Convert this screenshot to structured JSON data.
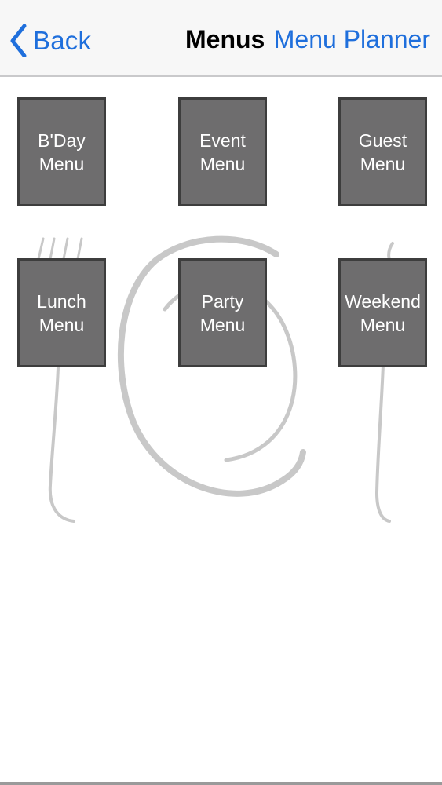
{
  "navbar": {
    "back_label": "Back",
    "title": "Menus",
    "right_label": "Menu Planner"
  },
  "menus": [
    {
      "line1": "B'Day",
      "line2": "Menu"
    },
    {
      "line1": "Event",
      "line2": "Menu"
    },
    {
      "line1": "Guest",
      "line2": "Menu"
    },
    {
      "line1": "Lunch",
      "line2": "Menu"
    },
    {
      "line1": "Party",
      "line2": "Menu"
    },
    {
      "line1": "Weekend",
      "line2": "Menu"
    }
  ],
  "colors": {
    "accent": "#1f6fdc",
    "tile_fill": "#6e6d6e",
    "tile_border": "#3d3d3d",
    "navbar_bg": "#f7f7f7",
    "art_stroke": "#c8c8c8"
  },
  "icons": {
    "back": "chevron-left-icon",
    "background_art": "plate-fork-knife-illustration"
  }
}
